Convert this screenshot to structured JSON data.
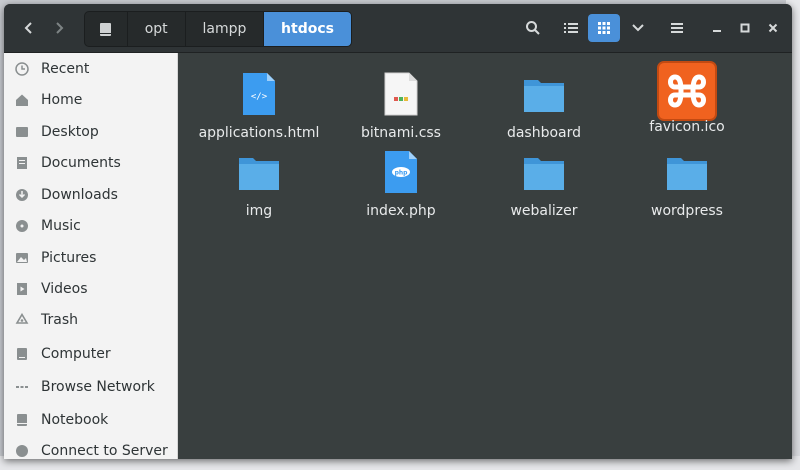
{
  "window": {
    "nav": {
      "back_icon": "chevron-left-icon",
      "forward_icon": "chevron-right-icon"
    },
    "breadcrumbs": [
      {
        "label": "",
        "icon": "drive-icon"
      },
      {
        "label": "opt"
      },
      {
        "label": "lampp"
      },
      {
        "label": "htdocs"
      }
    ],
    "toolbar": {
      "search_icon": "search-icon",
      "list_view_icon": "list-view-icon",
      "grid_view_icon": "grid-view-icon",
      "sort_icon": "chevron-down-icon",
      "menu_icon": "hamburger-menu-icon"
    },
    "window_controls": {
      "minimize_icon": "minimize-icon",
      "maximize_icon": "maximize-icon",
      "close_icon": "close-icon"
    }
  },
  "sidebar": {
    "items": [
      {
        "label": "Recent",
        "icon": "clock-icon"
      },
      {
        "label": "Home",
        "icon": "home-icon"
      },
      {
        "label": "Desktop",
        "icon": "desktop-icon"
      },
      {
        "label": "Documents",
        "icon": "documents-icon"
      },
      {
        "label": "Downloads",
        "icon": "downloads-icon"
      },
      {
        "label": "Music",
        "icon": "music-icon"
      },
      {
        "label": "Pictures",
        "icon": "pictures-icon"
      },
      {
        "label": "Videos",
        "icon": "videos-icon"
      },
      {
        "label": "Trash",
        "icon": "trash-icon"
      },
      {
        "label": "Computer",
        "icon": "computer-icon"
      },
      {
        "label": "Browse Network",
        "icon": "network-icon"
      },
      {
        "label": "Notebook",
        "icon": "drive-icon"
      },
      {
        "label": "Connect to Server",
        "icon": "server-icon"
      }
    ]
  },
  "files": [
    {
      "name": "applications.html",
      "icon": "html-file-icon"
    },
    {
      "name": "bitnami.css",
      "icon": "css-file-icon"
    },
    {
      "name": "dashboard",
      "icon": "folder-icon"
    },
    {
      "name": "favicon.ico",
      "icon": "xampp-logo-icon"
    },
    {
      "name": "img",
      "icon": "folder-icon"
    },
    {
      "name": "index.php",
      "icon": "php-file-icon"
    },
    {
      "name": "webalizer",
      "icon": "folder-icon"
    },
    {
      "name": "wordpress",
      "icon": "folder-icon"
    }
  ],
  "colors": {
    "accent": "#4a90d9",
    "headerbar": "#2f3436",
    "content_bg": "#393f3f",
    "sidebar_bg": "#f3f3f3",
    "folder": "#5aaee8",
    "xampp_orange": "#f0621f"
  }
}
